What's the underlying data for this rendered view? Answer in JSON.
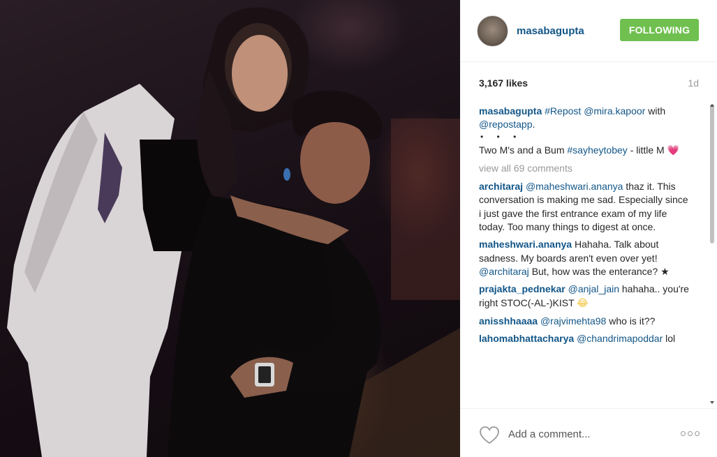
{
  "header": {
    "username": "masabagupta",
    "follow_label": "FOLLOWING"
  },
  "stats": {
    "likes": "3,167 likes",
    "age": "1d"
  },
  "caption": {
    "user": "masabagupta",
    "tag1": "#Repost",
    "mention1": "@mira.kapoor",
    "text1": "with",
    "mention2": "@repostapp",
    "text2": ".",
    "dots": "• • •",
    "text3": "Two M's and a Bum",
    "tag2": "#sayheytobey",
    "text4": "- little M",
    "emoji": "💗"
  },
  "view_all": "view all 69 comments",
  "comments": [
    {
      "user": "architaraj",
      "mention": "@maheshwari.ananya",
      "text": "thaz it. This conversation is making me sad. Especially since i just gave the first entrance exam of my life today. Too many things to digest at once.",
      "mention2": "",
      "text2": ""
    },
    {
      "user": "maheshwari.ananya",
      "mention": "",
      "text": "Hahaha. Talk about sadness. My boards aren't even over yet!",
      "mention2": "@architaraj",
      "text2": "But, how was the enterance? ★"
    },
    {
      "user": "prajakta_pednekar",
      "mention": "@anjal_jain",
      "text": "hahaha.. you're right STOC(-AL-)KIST",
      "mention2": "",
      "text2": "",
      "emoji": "😂"
    },
    {
      "user": "anisshhaaaa",
      "mention": "@rajvimehta98",
      "text": "who is it??",
      "mention2": "",
      "text2": ""
    },
    {
      "user": "lahomabhattacharya",
      "mention": "@chandrimapoddar",
      "text": "lol",
      "mention2": "",
      "text2": ""
    }
  ],
  "footer": {
    "placeholder": "Add a comment..."
  },
  "icons": {
    "like": "heart-outline-icon",
    "more": "more-options-icon"
  },
  "colors": {
    "link": "#125688",
    "follow_button": "#70c050",
    "muted": "#999999"
  }
}
